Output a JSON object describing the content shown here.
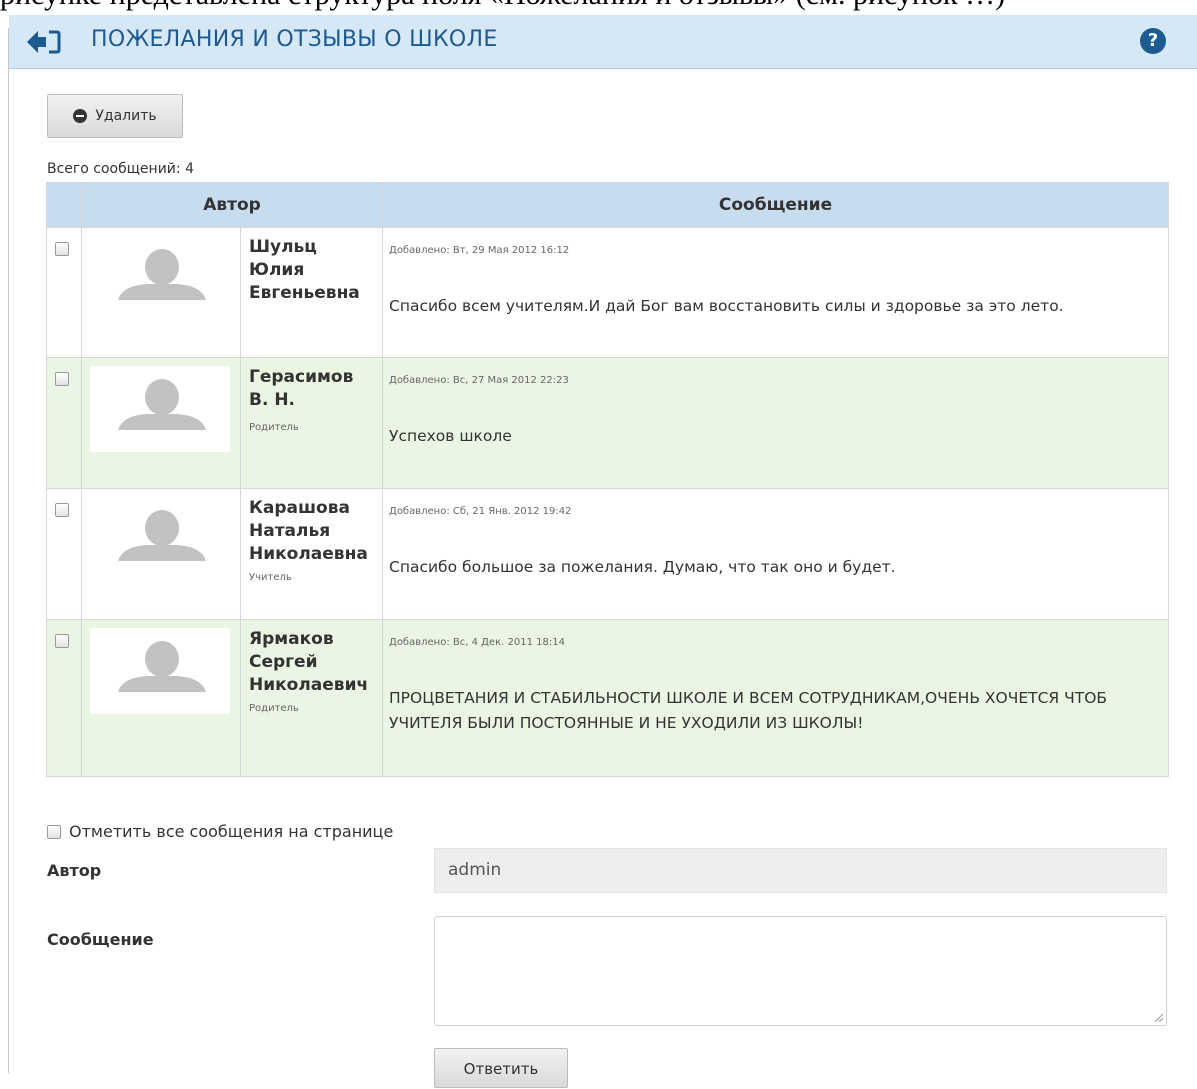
{
  "document": {
    "caption_fragment": "рисунке представлена структура поля «Пожелания и отзывы» (см. рисунок …)"
  },
  "header": {
    "title": "ПОЖЕЛАНИЯ И ОТЗЫВЫ О ШКОЛЕ",
    "help_glyph": "?"
  },
  "toolbar": {
    "delete_label": "Удалить"
  },
  "summary": {
    "total_label": "Всего сообщений: 4"
  },
  "table": {
    "columns": [
      "Автор",
      "Сообщение"
    ],
    "rows": [
      {
        "name_lines": [
          "Шульц",
          "Юлия",
          "Евгеньевна"
        ],
        "role": "",
        "added": "Добавлено: Вт, 29 Мая 2012 16:12",
        "text": "Спасибо всем учителям.И дай Бог вам восстановить силы и здоровье за это лето."
      },
      {
        "name_lines": [
          "Герасимов",
          "В. Н."
        ],
        "role": "Родитель",
        "added": "Добавлено: Вс, 27 Мая 2012 22:23",
        "text": "Успехов школе"
      },
      {
        "name_lines": [
          "Карашова",
          "Наталья",
          "Николаевна"
        ],
        "role": "Учитель",
        "added": "Добавлено: Сб, 21 Янв. 2012 19:42",
        "text": "Спасибо большое за пожелания. Думаю, что так оно и будет."
      },
      {
        "name_lines": [
          "Ярмаков",
          "Сергей",
          "Николаевич"
        ],
        "role": "Родитель",
        "added": "Добавлено: Вс, 4 Дек. 2011 18:14",
        "text": "ПРОЦВЕТАНИЯ И СТАБИЛЬНОСТИ ШКОЛЕ И ВСЕМ СОТРУДНИКАМ,ОЧЕНЬ ХОЧЕТСЯ ЧТОБ УЧИТЕЛЯ БЫЛИ ПОСТОЯННЫЕ И НЕ УХОДИЛИ ИЗ ШКОЛЫ!"
      }
    ]
  },
  "form": {
    "mark_all_label": "Отметить все сообщения на странице",
    "author_label": "Автор",
    "author_value": "admin",
    "message_label": "Сообщение",
    "message_value": "",
    "reply_label": "Ответить"
  },
  "colors": {
    "header_bg": "#d6e7f5",
    "title_color": "#1c5a92",
    "table_head_bg": "#c8dcef",
    "alt_row_bg": "#eaf5e3"
  }
}
